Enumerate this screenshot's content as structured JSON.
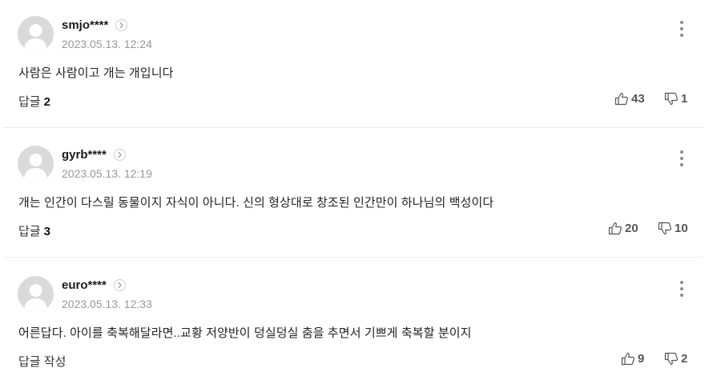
{
  "comments": [
    {
      "nickname": "smjo****",
      "date": "2023.05.13. 12:24",
      "text": "사람은 사람이고 개는 개입니다",
      "reply_label": "답글",
      "reply_count": "2",
      "likes": "43",
      "dislikes": "1"
    },
    {
      "nickname": "gyrb****",
      "date": "2023.05.13. 12:19",
      "text": "개는 인간이 다스릴 동물이지 자식이 아니다. 신의 형상대로 창조된 인간만이 하나님의 백성이다",
      "reply_label": "답글",
      "reply_count": "3",
      "likes": "20",
      "dislikes": "10"
    },
    {
      "nickname": "euro****",
      "date": "2023.05.13. 12:33",
      "text": "어른답다. 아이를 축복해달라면..교황 저양반이 덩실덩실 춤을 추면서 기쁘게 축복할 분이지",
      "reply_label": "답글 작성",
      "reply_count": "",
      "likes": "9",
      "dislikes": "2"
    }
  ],
  "icons": {
    "avatar": "default-profile-icon",
    "profile_link": "chevron-right-icon",
    "more": "more-vertical-icon",
    "like": "thumbs-up-icon",
    "dislike": "thumbs-down-icon"
  },
  "colors": {
    "meta": "#999999",
    "avatar_bg": "#dadada",
    "divider": "#ececec"
  }
}
